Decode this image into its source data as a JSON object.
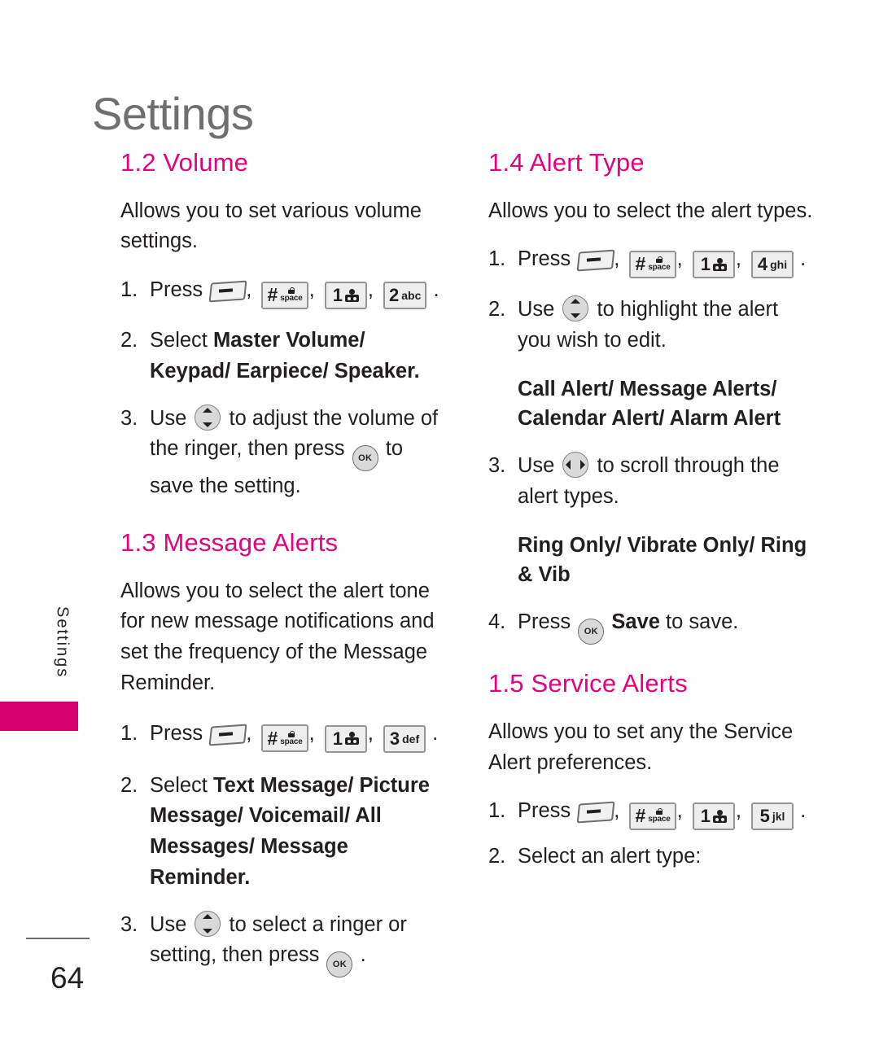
{
  "page": {
    "title": "Settings",
    "side_tab_label": "Settings",
    "page_number": "64"
  },
  "colors": {
    "heading_magenta": "#e5007d",
    "tab_magenta": "#d6006e",
    "title_gray": "#6f6f6f",
    "body_black": "#231f20"
  },
  "keys": {
    "menu": "menu-soft-key",
    "hash": "#",
    "hash_sub": "space",
    "hash_lock": "lock-icon",
    "one": "1",
    "one_glyph": "voicemail-icon",
    "two": "2",
    "two_letters": "abc",
    "three": "3",
    "three_letters": "def",
    "four": "4",
    "four_letters": "ghi",
    "five": "5",
    "five_letters": "jkl",
    "ok_label": "OK"
  },
  "left_column": {
    "sections": [
      {
        "heading": "1.2 Volume",
        "intro": "Allows you to set various volume settings.",
        "steps": [
          {
            "num": "1.",
            "lead": "Press",
            "keys": [
              "menu",
              "hash",
              "one",
              "two"
            ],
            "trail": "."
          },
          {
            "num": "2.",
            "lead": "Select",
            "bold": "Master Volume/ Keypad/ Earpiece/ Speaker",
            "trail": "."
          },
          {
            "num": "3.",
            "lead": "Use",
            "nav": "up-down",
            "mid": "to adjust the volume of the ringer, then press",
            "ok": true,
            "trail": "to save the setting."
          }
        ]
      },
      {
        "heading": "1.3 Message Alerts",
        "intro": "Allows you to select the alert tone for new message notifications and set the frequency of the Message Reminder.",
        "steps": [
          {
            "num": "1.",
            "lead": "Press",
            "keys": [
              "menu",
              "hash",
              "one",
              "three"
            ],
            "trail": "."
          },
          {
            "num": "2.",
            "lead": "Select",
            "bold": "Text Message/ Picture Message/ Voicemail/ All Messages/ Message Reminder",
            "trail": "."
          },
          {
            "num": "3.",
            "lead": "Use",
            "nav": "up-down",
            "mid": "to select a ringer or setting, then press",
            "ok": true,
            "trail": "."
          }
        ]
      }
    ]
  },
  "right_column": {
    "sections": [
      {
        "heading": "1.4 Alert Type",
        "intro": "Allows you to select the alert types.",
        "steps": [
          {
            "num": "1.",
            "lead": "Press",
            "keys": [
              "menu",
              "hash",
              "one",
              "four"
            ],
            "trail": "."
          },
          {
            "num": "2.",
            "lead": "Use",
            "nav": "up-down",
            "mid": "to highlight the alert you wish to edit."
          },
          {
            "options": "Call Alert/ Message Alerts/ Calendar Alert/ Alarm Alert"
          },
          {
            "num": "3.",
            "lead": "Use",
            "nav": "left-right",
            "mid": "to scroll through the alert types."
          },
          {
            "options": "Ring Only/ Vibrate Only/ Ring & Vib"
          },
          {
            "num": "4.",
            "lead": "Press",
            "ok": true,
            "bold": "Save",
            "trail": "to save."
          }
        ]
      },
      {
        "heading": "1.5 Service Alerts",
        "intro": "Allows you to set any the Service Alert preferences.",
        "steps": [
          {
            "num": "1.",
            "lead": "Press",
            "keys": [
              "menu",
              "hash",
              "one",
              "five"
            ],
            "trail": "."
          },
          {
            "num": "2.",
            "lead": "Select an alert type:"
          }
        ]
      }
    ]
  }
}
